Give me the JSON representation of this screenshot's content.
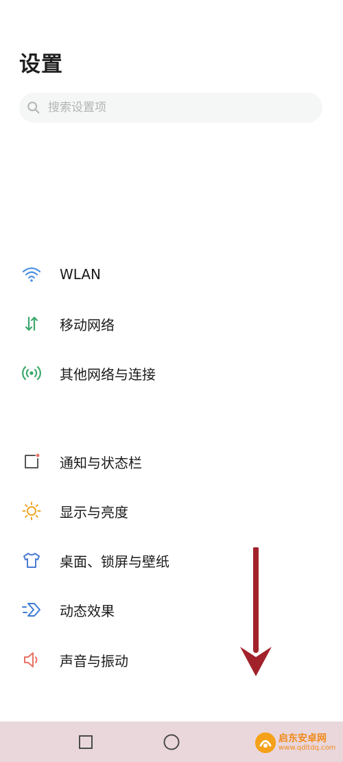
{
  "header": {
    "title": "设置"
  },
  "search": {
    "placeholder": "搜索设置项"
  },
  "groups": [
    {
      "items": [
        {
          "label": "WLAN",
          "icon": "wifi-icon",
          "color": "#4a90e2"
        },
        {
          "label": "移动网络",
          "icon": "mobile-data-icon",
          "color": "#3aa86b"
        },
        {
          "label": "其他网络与连接",
          "icon": "connection-icon",
          "color": "#3aa86b"
        }
      ]
    },
    {
      "items": [
        {
          "label": "通知与状态栏",
          "icon": "notification-icon",
          "color": "#e87060"
        },
        {
          "label": "显示与亮度",
          "icon": "brightness-icon",
          "color": "#f0a525"
        },
        {
          "label": "桌面、锁屏与壁纸",
          "icon": "shirt-icon",
          "color": "#4a7bd0"
        },
        {
          "label": "动态效果",
          "icon": "motion-icon",
          "color": "#3a7bd5"
        },
        {
          "label": "声音与振动",
          "icon": "speaker-icon",
          "color": "#e87060"
        }
      ]
    }
  ],
  "navbar": {
    "buttons": [
      "recent-apps",
      "home"
    ]
  },
  "watermark": {
    "name": "启东安卓网",
    "url": "www.qdltdq.com"
  },
  "colors": {
    "annotation_arrow": "#a1222b",
    "navbar_bg": "#ead7db"
  }
}
